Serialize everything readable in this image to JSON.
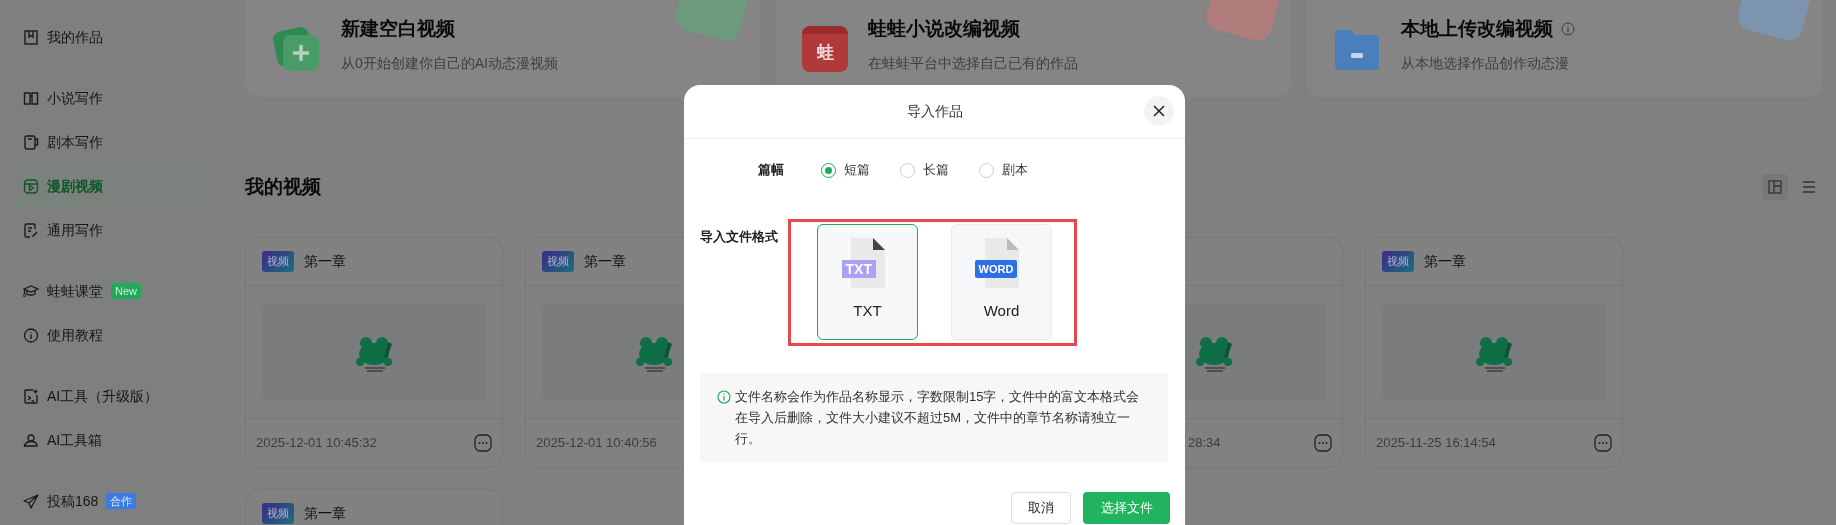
{
  "sidebar": {
    "groups": [
      [
        {
          "label": "我的作品",
          "selected": false
        }
      ],
      [
        {
          "label": "小说写作",
          "selected": false
        },
        {
          "label": "剧本写作",
          "selected": false
        },
        {
          "label": "漫剧视频",
          "selected": true
        },
        {
          "label": "通用写作",
          "selected": false
        }
      ],
      [
        {
          "label": "蛙蛙课堂",
          "selected": false,
          "badge": "New",
          "color": "#22a95c"
        },
        {
          "label": "使用教程",
          "selected": false
        }
      ],
      [
        {
          "label": "AI工具（升级版）",
          "selected": false
        },
        {
          "label": "AI工具箱",
          "selected": false
        }
      ],
      [
        {
          "label": "投稿168",
          "selected": false,
          "badge": "合作",
          "color": "#3b7be8"
        }
      ]
    ]
  },
  "actions": [
    {
      "title": "新建空白视频",
      "subtitle": "从0开始创建你自己的AI动态漫视频"
    },
    {
      "title": "蛙蛙小说改编视频",
      "subtitle": "在蛙蛙平台中选择自己已有的作品",
      "icon_text": "蛙"
    },
    {
      "title": "本地上传改编视频",
      "subtitle": "从本地选择作品创作动态漫"
    }
  ],
  "videos": {
    "title": "我的视频",
    "cards": [
      {
        "tag": "视频",
        "title": "第一章",
        "date": "2025-12-01 10:45:32",
        "menu": true
      },
      {
        "tag": "视频",
        "title": "第一章",
        "date": "2025-12-01 10:40:56"
      },
      {
        "date": "28:34",
        "menu": true
      },
      {
        "tag": "视频",
        "title": "第一章",
        "date": "2025-11-25 16:14:54",
        "menu": true
      },
      {
        "tag": "视频",
        "title": "第一章"
      }
    ]
  },
  "modal": {
    "title": "导入作品",
    "length_label": "篇幅",
    "lengths": [
      {
        "label": "短篇",
        "selected": true
      },
      {
        "label": "长篇",
        "selected": false
      },
      {
        "label": "剧本",
        "selected": false
      }
    ],
    "format_label": "导入文件格式",
    "formats": [
      {
        "label": "TXT",
        "badge": "TXT",
        "kind": "txt",
        "selected": true
      },
      {
        "label": "Word",
        "badge": "WORD",
        "kind": "word",
        "selected": false
      }
    ],
    "notice": "文件名称会作为作品名称显示，字数限制15字，文件中的富文本格式会在导入后删除，文件大小建议不超过5M，文件中的章节名称请独立一行。",
    "buttons": [
      {
        "label": "取消",
        "kind": "secondary"
      },
      {
        "label": "选择文件",
        "kind": "primary"
      }
    ]
  }
}
